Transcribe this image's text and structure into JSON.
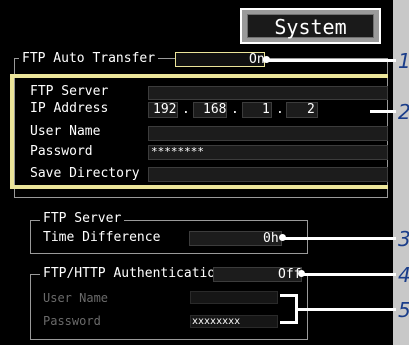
{
  "header": {
    "tab_label": "System"
  },
  "auto_transfer": {
    "label": "FTP Auto Transfer",
    "value": "On"
  },
  "ftp_server": {
    "section_label": "FTP Server",
    "ip_label": "IP Address",
    "ip": [
      "192",
      "168",
      "1",
      "2"
    ],
    "ip_sep": ".",
    "user_label": "User Name",
    "user_value": "",
    "password_label": "Password",
    "password_value": "********",
    "dir_label": "Save Directory",
    "dir_value": ""
  },
  "time_group": {
    "title": "FTP Server",
    "label": "Time Difference",
    "value": "0h"
  },
  "auth_group": {
    "title": "FTP/HTTP Authentication",
    "value": "Off",
    "user_label": "User Name",
    "password_label": "Password",
    "password_value": "xxxxxxxx"
  },
  "callouts": [
    "1",
    "2",
    "3",
    "4",
    "5"
  ],
  "colors": {
    "highlight": "#ece59a",
    "callout": "#1a3d8a",
    "panel": "#000000"
  }
}
